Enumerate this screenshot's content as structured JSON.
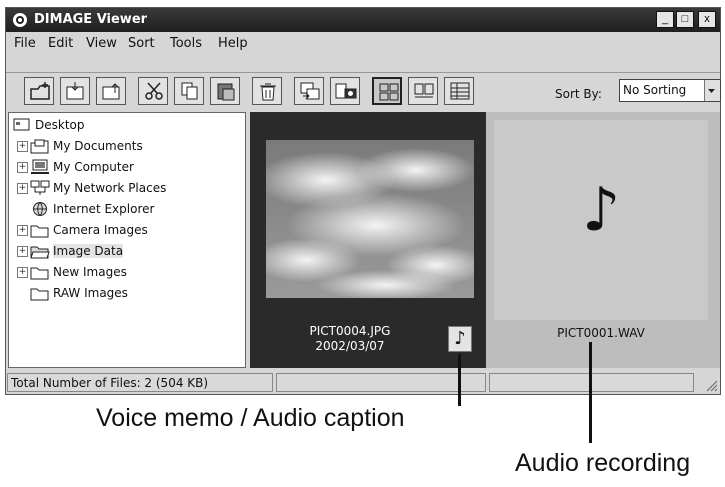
{
  "window": {
    "title": "DIMAGE Viewer",
    "controls": {
      "minimize": "_",
      "maximize": "□",
      "close": "x"
    }
  },
  "menu": [
    "File",
    "Edit",
    "View",
    "Sort",
    "Tools",
    "Help"
  ],
  "toolbar": {
    "buttons": [
      "new-folder-icon",
      "copy-in-icon",
      "copy-out-icon",
      "cut-icon",
      "copy-icon",
      "paste-icon",
      "delete-icon",
      "import-icon",
      "camera-icon",
      "thumbnails-icon",
      "large-icons-icon",
      "details-icon"
    ],
    "sort_label": "Sort By:",
    "sort_value": "No Sorting"
  },
  "tree": {
    "root": "Desktop",
    "items": [
      "My Documents",
      "My Computer",
      "My Network Places",
      "Internet Explorer",
      "Camera Images",
      "Image Data",
      "New Images",
      "RAW Images"
    ]
  },
  "thumbnails": [
    {
      "filename": "PICT0004.JPG",
      "date": "2002/03/07",
      "audio_icon": "♪"
    },
    {
      "filename": "PICT0001.WAV",
      "audio_icon": "♪"
    }
  ],
  "status": {
    "text": "Total Number of Files: 2 (504 KB)"
  },
  "annotations": {
    "voice_memo": "Voice memo / Audio caption",
    "audio_recording": "Audio recording"
  }
}
